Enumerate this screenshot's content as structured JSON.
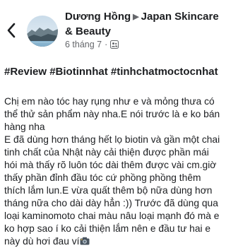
{
  "header": {
    "author": "Dương Hồng",
    "group": "Japan Skincare & Beauty",
    "date": "6 tháng 7",
    "separator": "·"
  },
  "hashtags": [
    "#Review",
    "#Biotinnhat",
    "#tinhchatmoctocnhat"
  ],
  "body": {
    "paragraph1": "Chị em nào tóc hay rụng như e và mỏng thưa có thể thử sản phẩm này nha.E nói trước là e ko bán hàng nha",
    "paragraph2": "E đã dùng hơn tháng hết lọ biotin và gần một chai tinh chất của Nhật này cải thiện được phần mái hói mà thấy rõ luôn tóc dài thêm được vài cm.giờ thấy phần đỉnh đầu tóc cứ phồng phồng thêm thích lắm lun.E vừa quất thêm bộ nữa dùng hơn tháng nữa cho dài dày hẳn :)) Trước đã dùng qua loại kaminomoto chai màu nâu loại mạnh đó mà e ko hợp sao í ko cải thiện lắm nên e đầu tư hai e này dù hơi đau ví"
  },
  "icons": {
    "back": "chevron-left-icon",
    "audience": "group-members-icon",
    "emoji": "camera-emoji-icon"
  }
}
